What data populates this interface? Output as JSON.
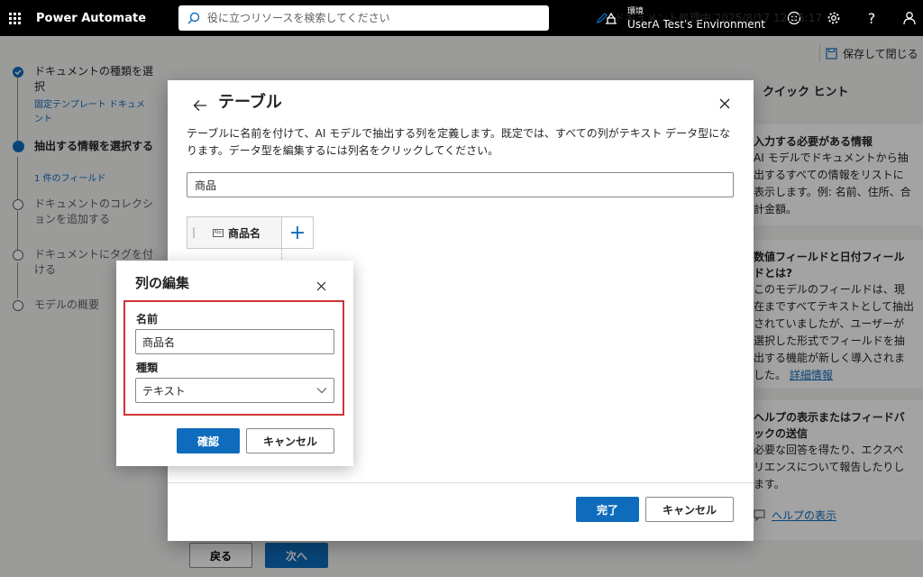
{
  "app": {
    "name": "Power Automate"
  },
  "search": {
    "placeholder": "役に立つリソースを検索してください"
  },
  "environment": {
    "label": "環境",
    "name": "UserA Test's Environment"
  },
  "header_icons": [
    "emoji-icon",
    "gear-icon",
    "help-icon",
    "person-icon"
  ],
  "status": {
    "text": "ドキュメント処理中 2025/8/17 12:15:17",
    "save_close": "保存して閉じる"
  },
  "steps": [
    {
      "title": "ドキュメントの種類を選択",
      "sub": "固定テンプレート ドキュメント",
      "state": "done"
    },
    {
      "title": "抽出する情報を選択する",
      "sub": "1 件のフィールド",
      "state": "current"
    },
    {
      "title": "ドキュメントのコレクションを追加する",
      "state": "todo"
    },
    {
      "title": "ドキュメントにタグを付ける",
      "state": "todo"
    },
    {
      "title": "モデルの概要",
      "state": "todo"
    }
  ],
  "hints": {
    "title": "クイック ヒント",
    "cards": [
      {
        "title": "入力する必要がある情報",
        "body": "AI モデルでドキュメントから抽出するすべての情報をリストに表示します。例: 名前、住所、合計金額。"
      },
      {
        "title": "数値フィールドと日付フィールドとは?",
        "body": "このモデルのフィールドは、現在まですべてテキストとして抽出されていましたが、ユーザーが選択した形式でフィールドを抽出する機能が新しく導入されました。",
        "link": "詳細情報"
      },
      {
        "title": "ヘルプの表示またはフィードバックの送信",
        "body": "必要な回答を得たり、エクスペリエンスについて報告したりします。"
      }
    ],
    "help_link": "ヘルプの表示"
  },
  "bottom_nav": {
    "back": "戻る",
    "next": "次へ"
  },
  "dialog": {
    "title": "テーブル",
    "description": "テーブルに名前を付けて、AI モデルで抽出する列を定義します。既定では、すべての列がテキスト データ型になります。データ型を編集するには列名をクリックしてください。",
    "table_name": "商品",
    "column_icon_text": "Abc",
    "columns": [
      {
        "name": "商品名"
      }
    ],
    "add_column_icon": "+",
    "done": "完了",
    "cancel": "キャンセル"
  },
  "popup": {
    "title": "列の編集",
    "name_label": "名前",
    "name_value": "商品名",
    "type_label": "種類",
    "type_value": "テキスト",
    "confirm": "確認",
    "cancel": "キャンセル"
  },
  "colors": {
    "accent": "#0f6cbd",
    "highlight": "#d13438",
    "topbar": "#000000"
  }
}
